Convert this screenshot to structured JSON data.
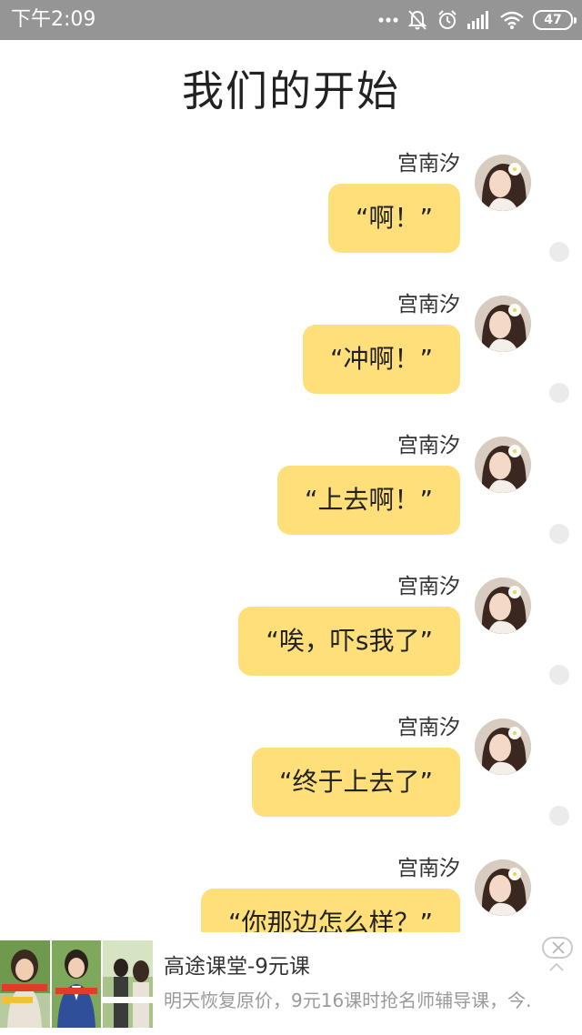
{
  "status_bar": {
    "time": "下午2:09",
    "battery": "47",
    "icons": [
      "more-dots-icon",
      "bell-muted-icon",
      "alarm-clock-icon",
      "signal-icon",
      "wifi-icon",
      "battery-icon"
    ]
  },
  "page": {
    "title": "我们的开始"
  },
  "messages": [
    {
      "name": "宫南汐",
      "text": "“啊！”"
    },
    {
      "name": "宫南汐",
      "text": "“冲啊！”"
    },
    {
      "name": "宫南汐",
      "text": "“上去啊！”"
    },
    {
      "name": "宫南汐",
      "text": "“唉，吓s我了”"
    },
    {
      "name": "宫南汐",
      "text": "“终于上去了”"
    },
    {
      "name": "宫南汐",
      "text": "“你那边怎么样？”"
    }
  ],
  "ad": {
    "title": "高途课堂-9元课",
    "description": "明天恢复原价，9元16课时抢名师辅导课，今.",
    "icons": [
      "close-icon",
      "chevron-up-icon"
    ]
  },
  "colors": {
    "status_bar_bg": "#959595",
    "bubble": "#ffdf7a",
    "title_text": "#222222",
    "ad_desc_text": "#9a9a9a"
  }
}
